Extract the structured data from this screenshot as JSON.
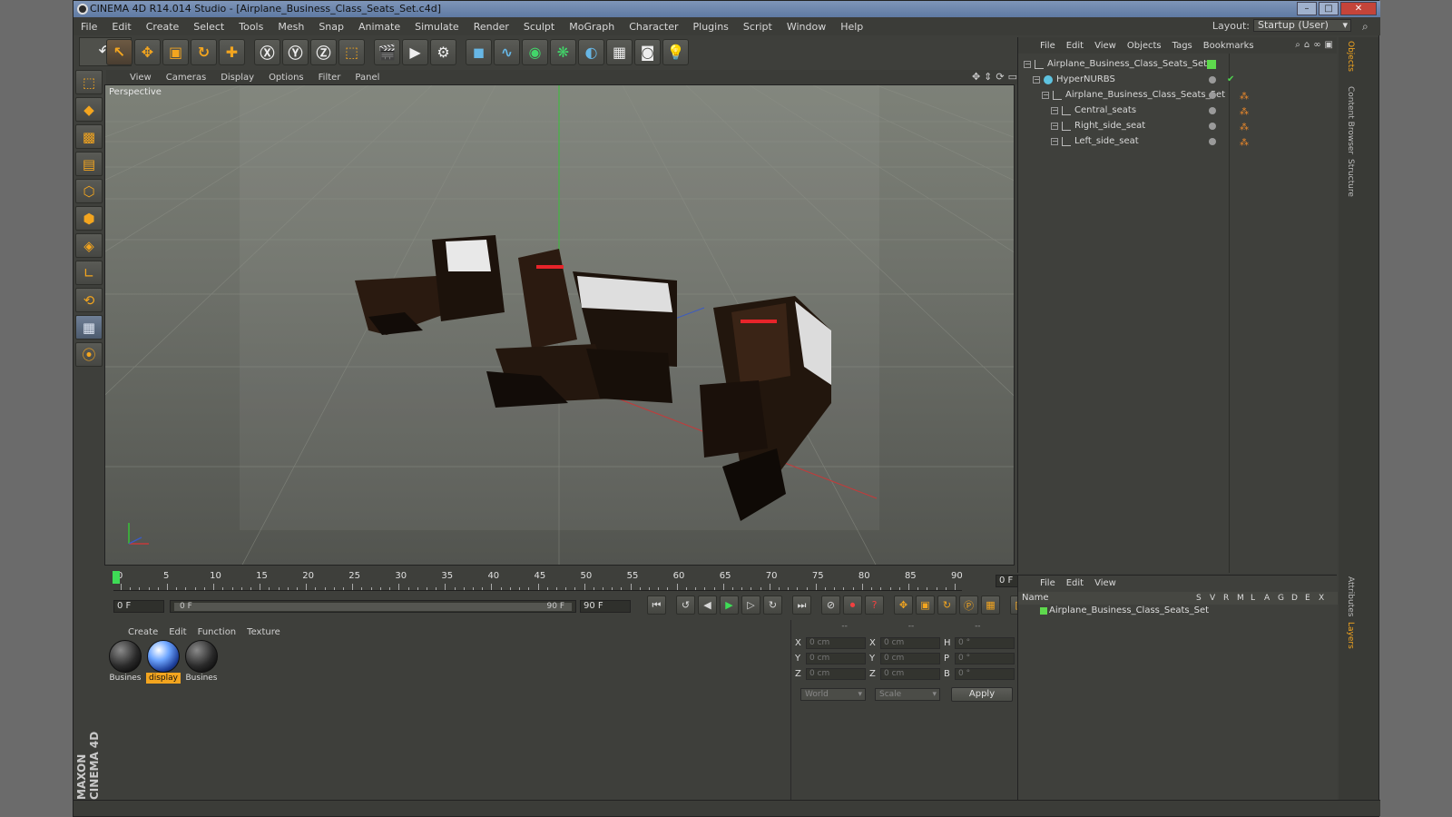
{
  "window": {
    "title": "CINEMA 4D R14.014 Studio - [Airplane_Business_Class_Seats_Set.c4d]"
  },
  "menubar": [
    "File",
    "Edit",
    "Create",
    "Select",
    "Tools",
    "Mesh",
    "Snap",
    "Animate",
    "Simulate",
    "Render",
    "Sculpt",
    "MoGraph",
    "Character",
    "Plugins",
    "Script",
    "Window",
    "Help"
  ],
  "layout": {
    "label": "Layout:",
    "value": "Startup (User)"
  },
  "viewport": {
    "menu": [
      "View",
      "Cameras",
      "Display",
      "Options",
      "Filter",
      "Panel"
    ],
    "label": "Perspective"
  },
  "timeline": {
    "ticks": [
      "0",
      "5",
      "10",
      "15",
      "20",
      "25",
      "30",
      "35",
      "40",
      "45",
      "50",
      "55",
      "60",
      "65",
      "70",
      "75",
      "80",
      "85",
      "90"
    ],
    "current_frame": "0 F",
    "start_field": "0 F",
    "range_start": "0 F",
    "range_end": "90 F",
    "end_field": "90 F"
  },
  "materials": {
    "menu": [
      "Create",
      "Edit",
      "Function",
      "Texture"
    ],
    "items": [
      {
        "label": "Busines",
        "selected": false
      },
      {
        "label": "display",
        "selected": true
      },
      {
        "label": "Busines",
        "selected": false
      }
    ]
  },
  "coords": {
    "headers": [
      "--",
      "--",
      "--"
    ],
    "rows": [
      {
        "l1": "X",
        "v1": "0 cm",
        "l2": "X",
        "v2": "0 cm",
        "l3": "H",
        "v3": "0 °"
      },
      {
        "l1": "Y",
        "v1": "0 cm",
        "l2": "Y",
        "v2": "0 cm",
        "l3": "P",
        "v3": "0 °"
      },
      {
        "l1": "Z",
        "v1": "0 cm",
        "l2": "Z",
        "v2": "0 cm",
        "l3": "B",
        "v3": "0 °"
      }
    ],
    "space": "World",
    "mode": "Scale",
    "apply": "Apply"
  },
  "object_manager": {
    "menu": [
      "File",
      "Edit",
      "View",
      "Objects",
      "Tags",
      "Bookmarks"
    ],
    "objects": [
      {
        "name": "Airplane_Business_Class_Seats_Set",
        "depth": 0,
        "kind": "null",
        "swatch": "#5ed94d"
      },
      {
        "name": "HyperNURBS",
        "depth": 1,
        "kind": "nurbs",
        "check": "✔"
      },
      {
        "name": "Airplane_Business_Class_Seats_Set",
        "depth": 2,
        "kind": "null",
        "tag": "⁂"
      },
      {
        "name": "Central_seats",
        "depth": 3,
        "kind": "null",
        "tag": "⁂"
      },
      {
        "name": "Right_side_seat",
        "depth": 3,
        "kind": "null",
        "tag": "⁂"
      },
      {
        "name": "Left_side_seat",
        "depth": 3,
        "kind": "null",
        "tag": "⁂"
      }
    ]
  },
  "layer_manager": {
    "menu": [
      "File",
      "Edit",
      "View"
    ],
    "columns": [
      "Name",
      "S",
      "V",
      "R",
      "M",
      "L",
      "A",
      "G",
      "D",
      "E",
      "X"
    ],
    "row": "Airplane_Business_Class_Seats_Set"
  },
  "side_tabs": [
    "Objects",
    "Content Browser",
    "Structure",
    "Attributes",
    "Layers"
  ],
  "branding": "MAXON CINEMA 4D",
  "colors": {
    "accent": "#f3a51f",
    "playhead": "#3edc56",
    "title": "#6b85ad"
  }
}
